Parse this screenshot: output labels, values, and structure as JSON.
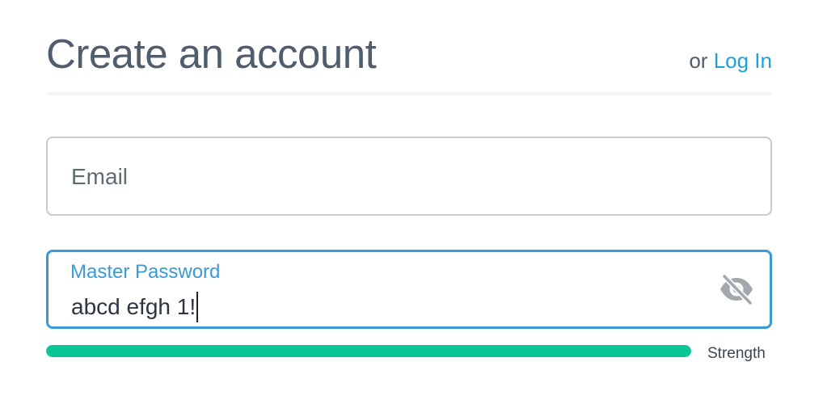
{
  "header": {
    "title": "Create an account",
    "or_text": "or",
    "login_label": "Log In"
  },
  "email": {
    "placeholder": "Email"
  },
  "password": {
    "label": "Master Password",
    "value": "abcd efgh 1!",
    "toggle_icon": "eye-slash-icon"
  },
  "strength": {
    "label": "Strength",
    "level": 1.0
  },
  "colors": {
    "title": "#505d6e",
    "link": "#1da1d6",
    "focus_border": "#3b9ad6",
    "strength_fill": "#0cc594"
  }
}
